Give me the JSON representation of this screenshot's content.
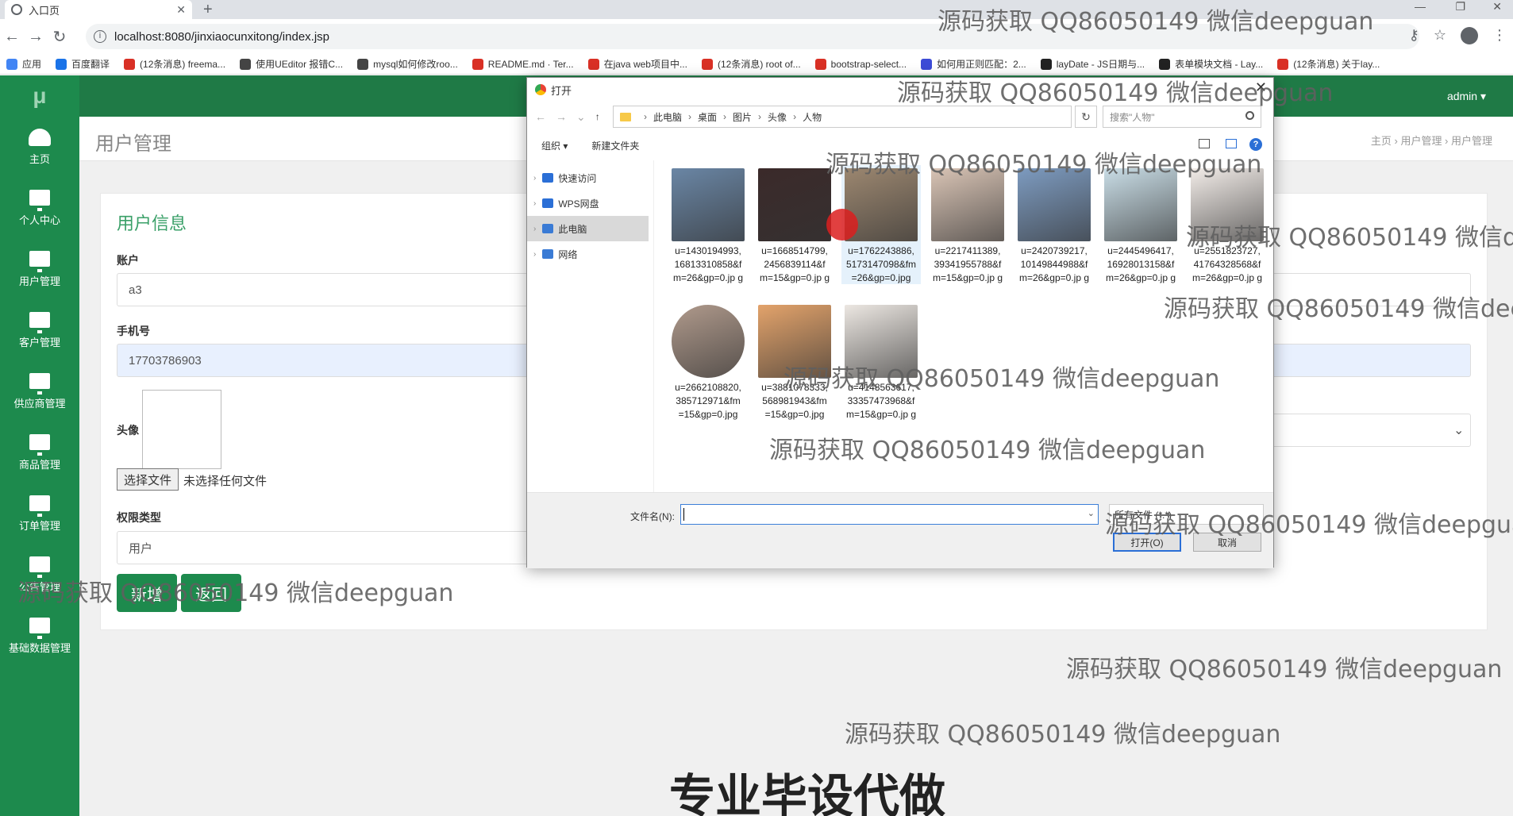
{
  "browser": {
    "tab_title": "入口页",
    "url": "localhost:8080/jinxiaocunxitong/index.jsp",
    "bookmarks": [
      "应用",
      "百度翻译",
      "(12条消息) freema...",
      "使用UEditor 报错C...",
      "mysql如何修改roo...",
      "README.md · Ter...",
      "在java web项目中...",
      "(12条消息) root of...",
      "bootstrap-select...",
      "如何用正则匹配：2...",
      "layDate - JS日期与...",
      "表单模块文档 - Lay...",
      "(12条消息) 关于lay..."
    ]
  },
  "app": {
    "logo": "μ",
    "admin": "admin ▾",
    "sidebar": [
      {
        "label": "主页",
        "icon": "dashboard-icon"
      },
      {
        "label": "个人中心",
        "icon": "monitor-icon"
      },
      {
        "label": "用户管理",
        "icon": "monitor-icon"
      },
      {
        "label": "客户管理",
        "icon": "monitor-icon"
      },
      {
        "label": "供应商管理",
        "icon": "monitor-icon"
      },
      {
        "label": "商品管理",
        "icon": "monitor-icon"
      },
      {
        "label": "订单管理",
        "icon": "monitor-icon"
      },
      {
        "label": "公告管理",
        "icon": "monitor-icon"
      },
      {
        "label": "基础数据管理",
        "icon": "monitor-icon"
      }
    ],
    "page_title": "用户管理",
    "breadcrumb": "主页 › 用户管理 › 用户管理",
    "form": {
      "title": "用户信息",
      "account_label": "账户",
      "account_value": "a3",
      "phone_label": "手机号",
      "phone_value": "17703786903",
      "avatar_label": "头像",
      "choose_file": "选择文件",
      "no_file": "未选择任何文件",
      "role_label": "权限类型",
      "role_value": "用户",
      "submit": "新增",
      "back": "返回"
    }
  },
  "dialog": {
    "title": "打开",
    "path": [
      "此电脑",
      "桌面",
      "图片",
      "头像",
      "人物"
    ],
    "search_placeholder": "搜索\"人物\"",
    "organize": "组织 ▾",
    "new_folder": "新建文件夹",
    "nav": [
      "快速访问",
      "WPS网盘",
      "此电脑",
      "网络"
    ],
    "files": [
      {
        "name": "u=1430194993, 16813310858&f m=26&gp=0.jp g",
        "color": "#6a86a5"
      },
      {
        "name": "u=1668514799, 2456839114&f m=15&gp=0.jp g",
        "color": "#3b2a2a"
      },
      {
        "name": "u=1762243886, 5173147098&fm =26&gp=0.jpg",
        "color": "#9c8770"
      },
      {
        "name": "u=2217411389, 39341955788&f m=15&gp=0.jp g",
        "color": "#d9c4b5"
      },
      {
        "name": "u=2420739217, 10149844988&f m=26&gp=0.jp g",
        "color": "#7d9bc0"
      },
      {
        "name": "u=2445496417, 16928013158&f m=26&gp=0.jp g",
        "color": "#c9dde6"
      },
      {
        "name": "u=2551823727, 41764328568&f m=26&gp=0.jp g",
        "color": "#f2ece8"
      },
      {
        "name": "u=2662108820, 385712971&fm =15&gp=0.jpg",
        "color": "#b09a8c"
      },
      {
        "name": "u=3881078333, 568981943&fm =15&gp=0.jpg",
        "color": "#e3a36b"
      },
      {
        "name": "u=4148563617, 33357473968&f m=15&gp=0.jp g",
        "color": "#ece7e2"
      }
    ],
    "filename_label": "文件名(N):",
    "filetype": "所有文件 (*.*)",
    "open": "打开(O)",
    "cancel": "取消"
  },
  "overlay": {
    "watermark": "源码获取 QQ86050149 微信deepguan",
    "banner": "专业毕设代做"
  }
}
